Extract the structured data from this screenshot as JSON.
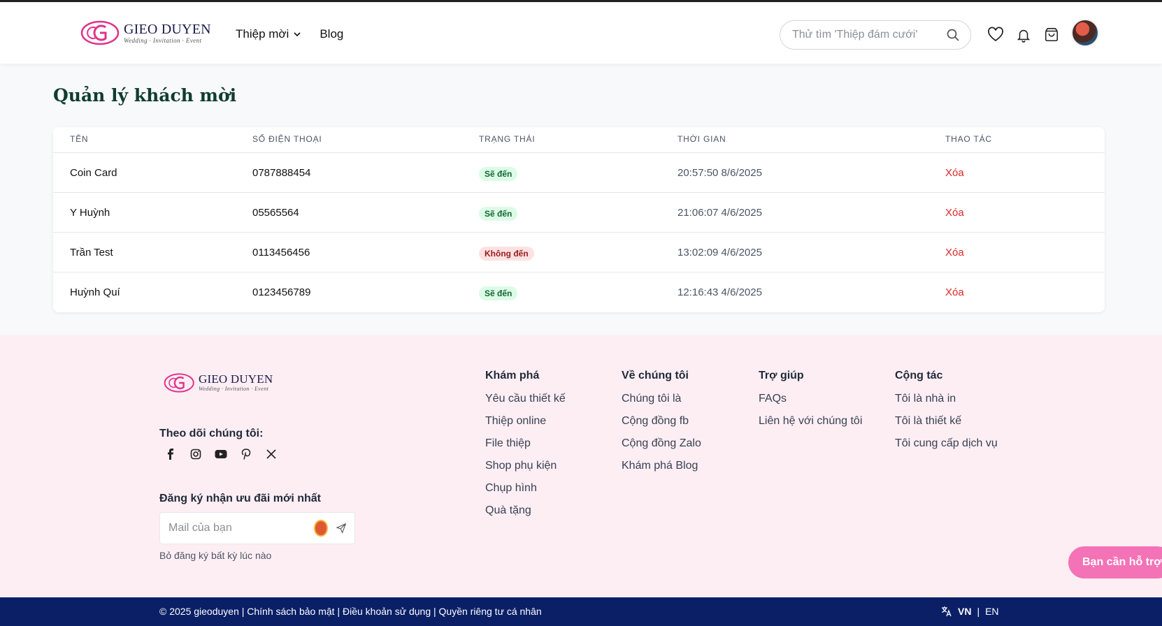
{
  "brand": {
    "name": "GIEO DUYEN",
    "tagline": "Wedding · Invitation · Event"
  },
  "nav": {
    "items": [
      {
        "label": "Thiệp mời",
        "has_dropdown": true
      },
      {
        "label": "Blog",
        "has_dropdown": false
      }
    ]
  },
  "search": {
    "placeholder": "Thử tìm 'Thiệp đám cưới'"
  },
  "header_icons": [
    "heart-icon",
    "bell-icon",
    "shopping-bag-icon",
    "avatar"
  ],
  "page": {
    "title": "Quản lý khách mời"
  },
  "table": {
    "columns": [
      "TÊN",
      "SỐ ĐIỆN THOẠI",
      "TRẠNG THÁI",
      "THỜI GIAN",
      "THAO TÁC"
    ],
    "rows": [
      {
        "name": "Coin Card",
        "phone": "0787888454",
        "status": "Sẽ đến",
        "status_type": "yes",
        "time": "20:57:50 8/6/2025",
        "action": "Xóa"
      },
      {
        "name": "Y Huỳnh",
        "phone": "05565564",
        "status": "Sẽ đến",
        "status_type": "yes",
        "time": "21:06:07 4/6/2025",
        "action": "Xóa"
      },
      {
        "name": "Trần Test",
        "phone": "0113456456",
        "status": "Không đến",
        "status_type": "no",
        "time": "13:02:09 4/6/2025",
        "action": "Xóa"
      },
      {
        "name": "Huỳnh Quí",
        "phone": "0123456789",
        "status": "Sẽ đến",
        "status_type": "yes",
        "time": "12:16:43 4/6/2025",
        "action": "Xóa"
      }
    ]
  },
  "footer": {
    "follow_label": "Theo dõi chúng tôi:",
    "social": [
      "facebook-icon",
      "instagram-icon",
      "youtube-icon",
      "pinterest-icon",
      "x-icon"
    ],
    "subscribe_label": "Đăng ký nhận ưu đãi mới nhất",
    "mail_placeholder": "Mail của bạn",
    "unsubscribe_hint": "Bỏ đăng ký bất kỳ lúc nào",
    "columns": [
      {
        "title": "Khám phá",
        "links": [
          "Yêu cầu thiết kế",
          "Thiệp online",
          "File thiệp",
          "Shop phụ kiện",
          "Chụp hình",
          "Quà tặng"
        ]
      },
      {
        "title": "Về chúng tôi",
        "links": [
          "Chúng tôi là",
          "Cộng đồng fb",
          "Cộng đồng Zalo",
          "Khám phá Blog"
        ]
      },
      {
        "title": "Trợ giúp",
        "links": [
          "FAQs",
          "Liên hệ với chúng tôi"
        ]
      },
      {
        "title": "Cộng tác",
        "links": [
          "Tôi là nhà in",
          "Tôi là thiết kế",
          "Tôi cung cấp dịch vụ"
        ]
      }
    ],
    "help_button": "Bạn cần hỗ trợ?"
  },
  "bottom": {
    "copyright": "© 2025 gieoduyen | Chính sách bảo mật | Điều khoản sử dụng | Quyền riêng tư cá nhân",
    "lang_vn": "VN",
    "lang_sep": "|",
    "lang_en": "EN"
  },
  "colors": {
    "brand_pink": "#e0338a",
    "title_green": "#0f3d2e",
    "delete_red": "#dc2626",
    "footer_bg": "#fdeef4",
    "bottom_bar": "#0a1f66"
  }
}
